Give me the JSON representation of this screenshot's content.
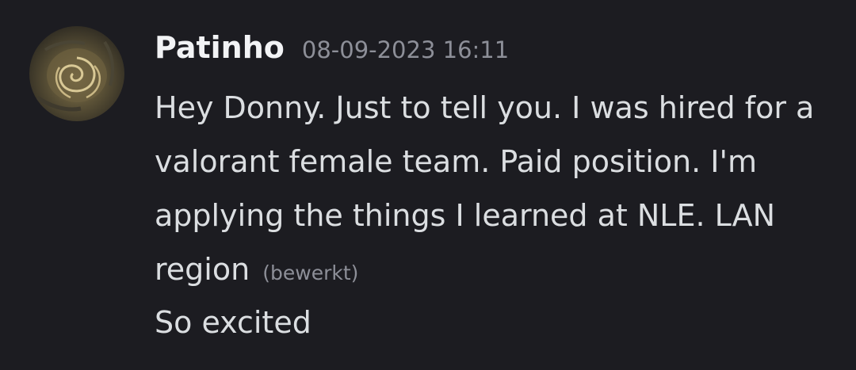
{
  "message": {
    "avatar_icon": "rose-tattoo-avatar",
    "username": "Patinho",
    "timestamp": "08-09-2023 16:11",
    "text": "Hey Donny. Just to tell you. I was hired for a valorant female team. Paid position. I'm applying the things I learned at NLE. LAN region",
    "edited_label": "(bewerkt)",
    "followup_text": "So excited"
  },
  "colors": {
    "background": "#1c1c21",
    "username": "#f2f3f5",
    "message_text": "#dbdee1",
    "muted": "#8d8f98"
  }
}
